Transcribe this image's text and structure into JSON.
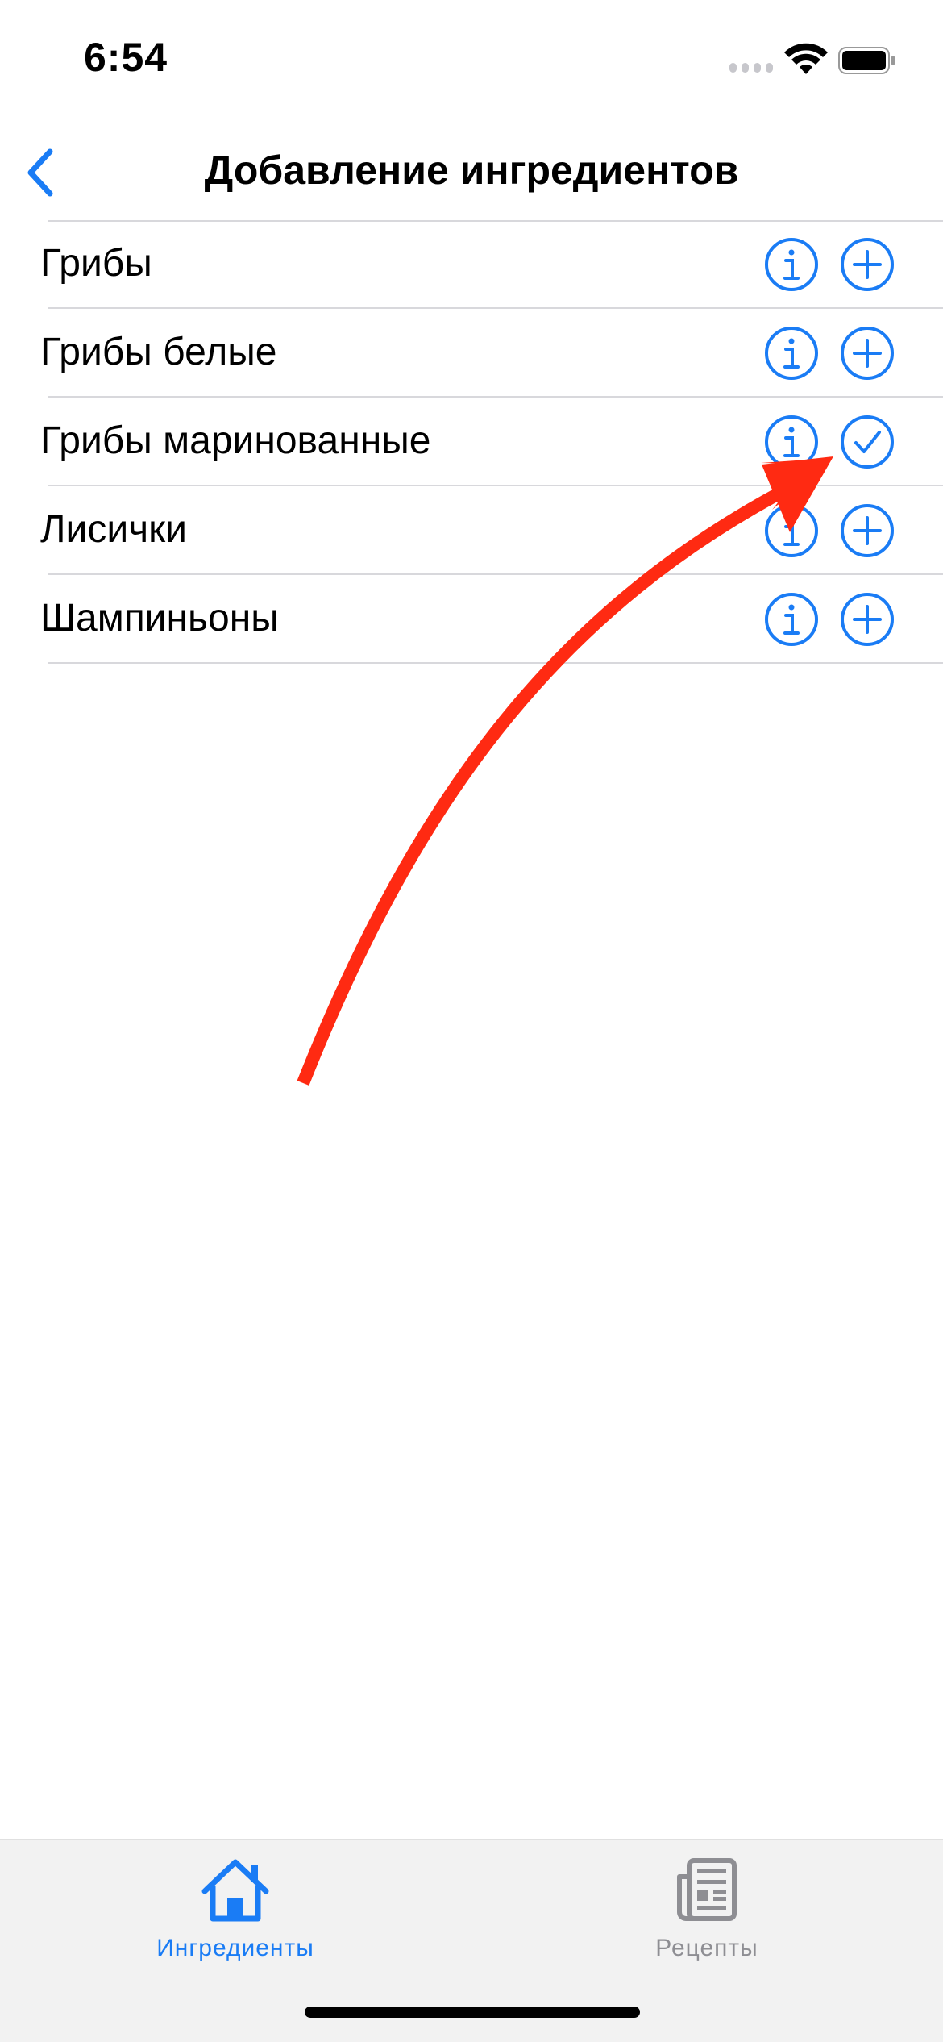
{
  "status_bar": {
    "time": "6:54"
  },
  "nav": {
    "title": "Добавление ингредиентов"
  },
  "ingredients": [
    {
      "name": "Грибы",
      "action": "add"
    },
    {
      "name": "Грибы белые",
      "action": "add"
    },
    {
      "name": "Грибы маринованные",
      "action": "added"
    },
    {
      "name": "Лисички",
      "action": "add"
    },
    {
      "name": "Шампиньоны",
      "action": "add"
    }
  ],
  "tab_bar": {
    "tabs": [
      {
        "label": "Ингредиенты",
        "icon": "house-icon",
        "selected": true
      },
      {
        "label": "Рецепты",
        "icon": "newspaper-icon",
        "selected": false
      }
    ]
  },
  "colors": {
    "accent": "#1a7cf5",
    "annotation": "#ff2a12",
    "inactive": "#8e8e93"
  }
}
